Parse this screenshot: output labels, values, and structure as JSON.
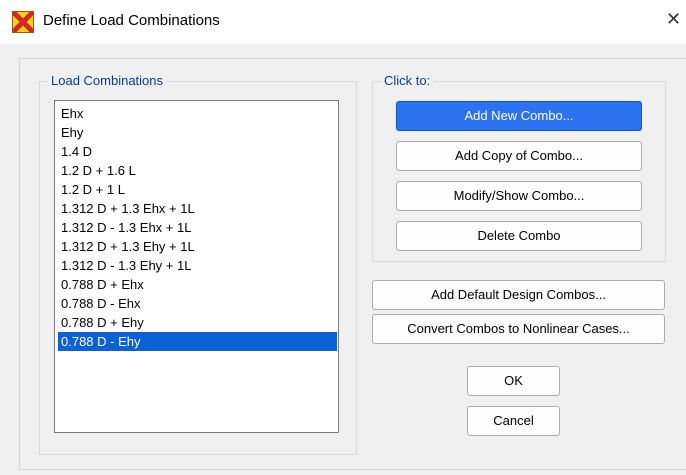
{
  "window": {
    "title": "Define Load Combinations"
  },
  "combos_group": {
    "legend": "Load Combinations",
    "items": [
      "Ehx",
      "Ehy",
      "1.4 D",
      "1.2 D + 1.6 L",
      "1.2 D + 1 L",
      "1.312 D + 1.3 Ehx + 1L",
      "1.312 D - 1.3 Ehx + 1L",
      "1.312 D + 1.3 Ehy + 1L",
      "1.312 D - 1.3 Ehy + 1L",
      "0.788 D + Ehx",
      "0.788 D - Ehx",
      "0.788 D + Ehy",
      "0.788 D - Ehy"
    ],
    "selected": "0.788 D - Ehy"
  },
  "click_group": {
    "legend": "Click to:",
    "add_new": "Add New Combo...",
    "add_copy": "Add Copy of Combo...",
    "modify": "Modify/Show Combo...",
    "delete": "Delete Combo"
  },
  "actions": {
    "add_default": "Add Default Design Combos...",
    "convert": "Convert Combos to Nonlinear Cases...",
    "ok": "OK",
    "cancel": "Cancel"
  },
  "colors": {
    "accent": "#0a61d6",
    "legend": "#0b3a99",
    "primary_button": "#2a72f0"
  }
}
